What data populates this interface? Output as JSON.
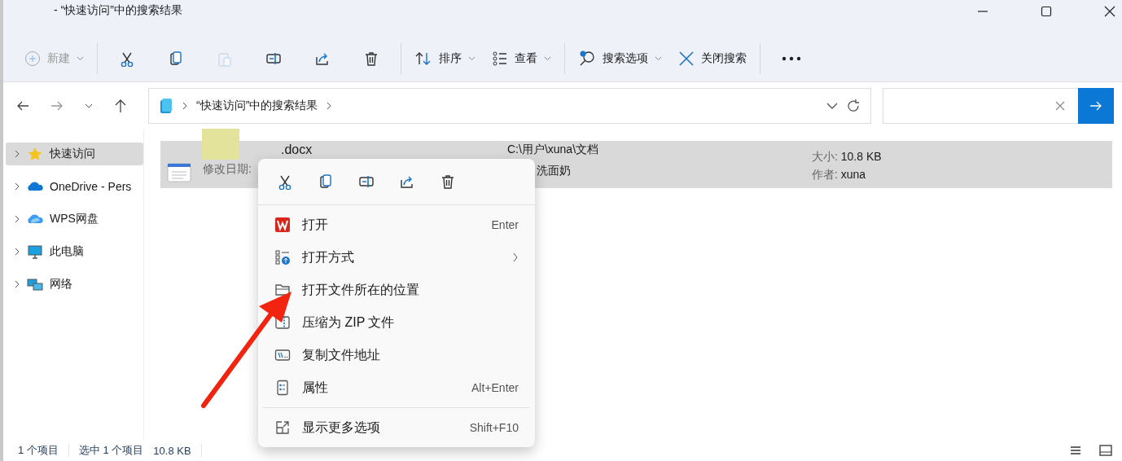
{
  "window": {
    "title": "- “快速访问”中的搜索结果"
  },
  "toolbar": {
    "new": {
      "label": "新建",
      "disabled": true
    },
    "edit_actions": [
      {
        "disabled": false
      },
      {
        "disabled": false
      },
      {
        "disabled": true
      },
      {
        "disabled": false
      },
      {
        "disabled": false
      },
      {
        "disabled": false
      }
    ],
    "sort": {
      "label": "排序"
    },
    "view": {
      "label": "查看"
    },
    "search_options": {
      "label": "搜索选项"
    },
    "close_search": {
      "label": "关闭搜索"
    }
  },
  "address_bar": {
    "path": "“快速访问”中的搜索结果"
  },
  "sidebar": {
    "items": [
      {
        "label": "快速访问",
        "selected": true
      },
      {
        "label": "OneDrive - Pers",
        "selected": false
      },
      {
        "label": "WPS网盘",
        "selected": false
      },
      {
        "label": "此电脑",
        "selected": false
      },
      {
        "label": "网络",
        "selected": false
      }
    ]
  },
  "result": {
    "name": ".docx",
    "date_label": "修改日期:",
    "path": "C:\\用户\\xuna\\文档",
    "detail": "洗面奶",
    "size_label": "大小:",
    "size": "10.8 KB",
    "author_label": "作者:",
    "author": "xuna",
    "selected": true
  },
  "context_menu": {
    "items": [
      {
        "kind": "item",
        "label": "打开",
        "shortcut": "Enter",
        "submenu": false
      },
      {
        "kind": "item",
        "label": "打开方式",
        "submenu": true
      },
      {
        "kind": "item",
        "label": "打开文件所在的位置",
        "submenu": false
      },
      {
        "kind": "item",
        "label": "压缩为 ZIP 文件",
        "submenu": false
      },
      {
        "kind": "item",
        "label": "复制文件地址",
        "submenu": false
      },
      {
        "kind": "item",
        "label": "属性",
        "shortcut": "Alt+Enter",
        "submenu": false
      },
      {
        "kind": "separator"
      },
      {
        "kind": "item",
        "label": "显示更多选项",
        "shortcut": "Shift+F10",
        "submenu": false
      }
    ]
  },
  "status_bar": {
    "count": "1 个项目",
    "selection": "选中 1 个项目",
    "size": "10.8 KB"
  }
}
